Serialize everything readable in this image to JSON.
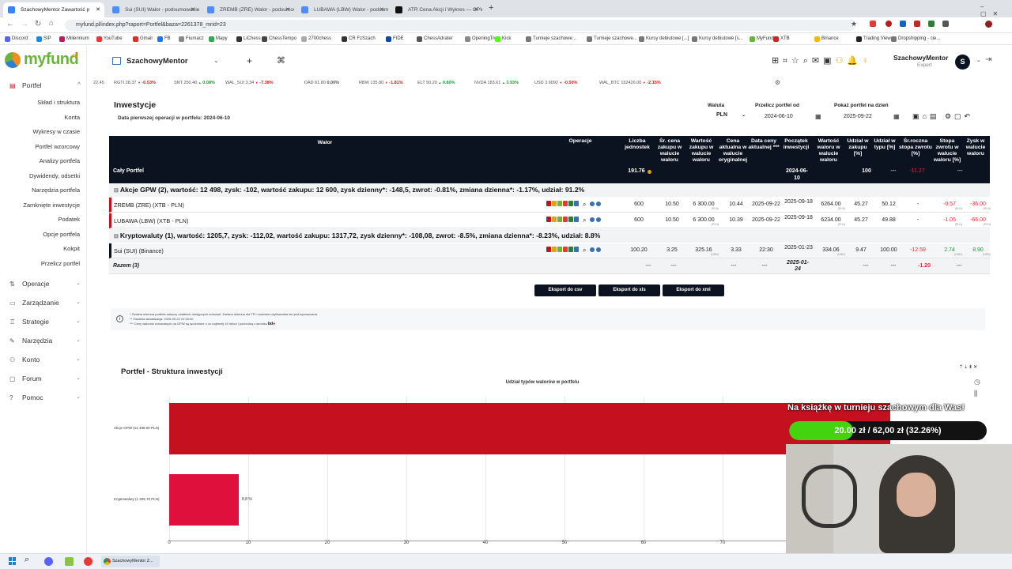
{
  "browser": {
    "tabs": [
      {
        "title": "SzachowyMentor Zawartość p",
        "fav": "#3b82f6",
        "active": true
      },
      {
        "title": "Sui (SUI) Walor - podsumowanie",
        "fav": "#4f8ef7"
      },
      {
        "title": "ZREMB (ZRE) Walor - podsumowanie",
        "fav": "#4f8ef7"
      },
      {
        "title": "LUBAWA (LBW) Walor - podsum",
        "fav": "#4f8ef7"
      },
      {
        "title": "ATR Cena Akcji i Wykres — GPW",
        "fav": "#111111"
      }
    ],
    "url": "myfund.pl/index.php?raport=Portfel&baza=2261378_mrid=23",
    "bookmarks": [
      "Discord",
      "SIP",
      "Millennium",
      "YouTube",
      "Gmail",
      "FB",
      "Fiumacz",
      "Mapy",
      "LiChess",
      "ChessTempo",
      "2700chess",
      "CR FzSzach",
      "FIDE",
      "ChessAdrater",
      "OpeningTree",
      "Kick",
      "Turnieje szachowe...",
      "Turnieje szachowe...",
      "Kursy debiutowe [...]",
      "Kursy debiutowe [s...",
      "MyFund",
      "XTB",
      "Binance",
      "Trading View",
      "Dropshipping - cie..."
    ]
  },
  "app": {
    "logo": "myfund",
    "logo_suffix": ".pl",
    "portfolio_name": "SzachowyMentor",
    "user_name": "SzachowyMentor",
    "user_role": "Expert",
    "avatar_letter": "S"
  },
  "sidebar": {
    "portfel": "Portfel",
    "sub": [
      "Skład i struktura",
      "Konta",
      "Wykresy w czasie",
      "Portfel wzorcowy",
      "Analizy portfela",
      "Dywidendy, odsetki",
      "Narzędzia portfela",
      "Zamknięte inwestycje",
      "Podatek",
      "Opcje portfela",
      "Kokpit",
      "Przelicz portfel"
    ],
    "sections": [
      "Operacje",
      "Zarządzanie",
      "Strategie",
      "Narzędzia",
      "Konto",
      "Forum",
      "Pomoc"
    ]
  },
  "ticker": [
    {
      "n": "22.45",
      "v": "",
      "c": "",
      "d": ""
    },
    {
      "n": "RGTI",
      "v": "28.37",
      "c": "-0.53%",
      "d": "dn"
    },
    {
      "n": "SNT",
      "v": "250.40",
      "c": "0.08%",
      "d": "u"
    },
    {
      "n": "WAL_SUI",
      "v": "3.34",
      "c": "-7.38%",
      "d": "dn"
    },
    {
      "n": "DAD",
      "v": "61.80",
      "c": "0.00%",
      "d": ""
    },
    {
      "n": "RBW",
      "v": "135.80",
      "c": "-1.81%",
      "d": "dn"
    },
    {
      "n": "ELT",
      "v": "50.20",
      "c": "0.80%",
      "d": "u"
    },
    {
      "n": "NVDA",
      "v": "183.61",
      "c": "3.93%",
      "d": "u"
    },
    {
      "n": "USD",
      "v": "3.6092",
      "c": "-0.50%",
      "d": "dn"
    },
    {
      "n": "WAL_BTC",
      "v": "152426.00",
      "c": "-2.15%",
      "d": "dn"
    }
  ],
  "investments": {
    "title": "Inwestycje",
    "first_op": "Data pierwszej operacji w portfelu: 2024-06-10",
    "currency_label": "Waluta",
    "currency": "PLN",
    "recalc_label": "Przelicz portfel od",
    "recalc_date": "2024-06-10",
    "show_label": "Pokaż portfel na dzień",
    "show_date": "2025-09-22"
  },
  "table": {
    "headers": [
      "Walor",
      "Operacje",
      "Liczba jednostek",
      "Śr. cena zakupu w walucie waloru",
      "Wartość zakupu w walucie waloru",
      "Cena aktualna w walucie oryginalnej",
      "Data ceny aktualnej ***",
      "Początek inwestycji",
      "Wartość waloru w walucie waloru",
      "Udział w zakupu [%]",
      "Udział w typu [%]",
      "Śr.roczna stopa zwrotu [%]",
      "Stopa zwrotu w walucie waloru [%]",
      "Zysk w walucie waloru"
    ],
    "whole": {
      "name": "Cały Portfel",
      "units": "191.76",
      "start": "2024-06-10",
      "share": "100",
      "share_type": "---",
      "annual": "-11.27",
      "profit": "---"
    },
    "group1": "Akcje GPW (2), wartość: 12 498, zysk: -102, wartość zakupu: 12 600, zysk dzienny*: -148,5, zwrot: -0.81%, zmiana dzienna*: -1.17%, udział: 91.2%",
    "rows1": [
      {
        "name": "ZREMB (ZRE) (XTB - PLN)",
        "units": "600",
        "avg": "10.50",
        "buy": "6 300.00",
        "price": "10.44",
        "date": "2025-09-22",
        "start": "2025-09-18",
        "value": "6264.00",
        "share": "45.27",
        "share_type": "50.12",
        "annual": "-",
        "ret": "-0.57",
        "profit": "-36.00"
      },
      {
        "name": "LUBAWA (LBW) (XTB - PLN)",
        "units": "600",
        "avg": "10.50",
        "buy": "6 300.00",
        "price": "10.39",
        "date": "2025-09-22",
        "start": "2025-09-18",
        "value": "6234.00",
        "share": "45.27",
        "share_type": "49.88",
        "annual": "-",
        "ret": "-1.05",
        "profit": "-66.00"
      }
    ],
    "group2": "Kryptowaluty (1), wartość: 1205,7, zysk: -112,02, wartość zakupu: 1317,72, zysk dzienny*: -108,08, zwrot: -8.5%, zmiana dzienna*: -8.23%, udział: 8.8%",
    "rows2": [
      {
        "name": "Sui (SUI) (Binance)",
        "units": "100.20",
        "avg": "3.25",
        "buy": "325.16",
        "price": "3.33",
        "date": "22:30",
        "start": "2025-01-23",
        "value": "334.06",
        "share": "9.47",
        "share_type": "100.00",
        "annual": "-12.59",
        "ret": "2.74",
        "profit": "8.90"
      }
    ],
    "total": {
      "name": "Razem (3)",
      "start": "2025-01-24",
      "annual": "-1.20",
      "dash": "---"
    },
    "sub_usd": "(USD)",
    "sub_pln": "(PLN)"
  },
  "exports": [
    "Eksport do csv",
    "Eksport do xls",
    "Eksport do xml"
  ],
  "notes": [
    "* Zmiana dzienna portfela dotyczy ostatnich dostępnych notowań. Zmiana dzienna dla TFI i walorów użytkownika nie jest wyznaczana.",
    "** Ostatnia aktualizacja: 2025-09-22 22:30:00",
    "*** Ceny walorów notowanych na GPW są opóźnione o co najmniej 15 minut i pochodzą z serwisu"
  ],
  "chart_section": {
    "title": "Portfel - Struktura inwestycji"
  },
  "chart_data": {
    "type": "bar",
    "title": "Udział typów walorów w portfelu",
    "categories": [
      "Akcje GPW (12 498.00 PLN)",
      "Kryptowaluty (1 205.70 PLN)"
    ],
    "values": [
      91.2,
      8.8
    ],
    "value_labels": [
      "",
      "8.8 %"
    ],
    "xticks": [
      0,
      10,
      20,
      30,
      40,
      50,
      60,
      70
    ],
    "xlim": [
      0,
      100
    ],
    "colors": [
      "#c4101f",
      "#e0103c"
    ]
  },
  "overlay": {
    "banner": "Na książkę w turnieju szachowym dla Was!",
    "progress_text": "20.00 zł / 62,00 zł (32.26%)",
    "progress": 0.3226
  },
  "taskbar": {
    "active_app": "SzachowyMentor Z..."
  }
}
